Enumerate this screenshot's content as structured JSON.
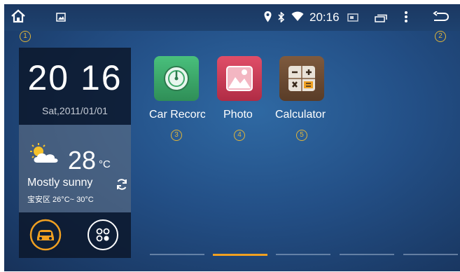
{
  "statusbar": {
    "time": "20:16",
    "markers": {
      "home": "1",
      "back": "2"
    }
  },
  "widget": {
    "clock_time": "20 16",
    "date": "Sat,2011/01/01",
    "weather": {
      "temperature": "28",
      "unit": "°C",
      "description": "Mostly sunny",
      "range": "宝安区 26°C~ 30°C"
    }
  },
  "apps": [
    {
      "label": "Car Recorc",
      "marker": "3",
      "color": "#3ea86a"
    },
    {
      "label": "Photo",
      "marker": "4",
      "color": "#c93a54"
    },
    {
      "label": "Calculator",
      "marker": "5",
      "color": "#6b4a33"
    }
  ],
  "pager": {
    "pages": 5,
    "active_page": 2
  },
  "colors": {
    "accent": "#f0a021",
    "marker": "#e0b53a"
  }
}
